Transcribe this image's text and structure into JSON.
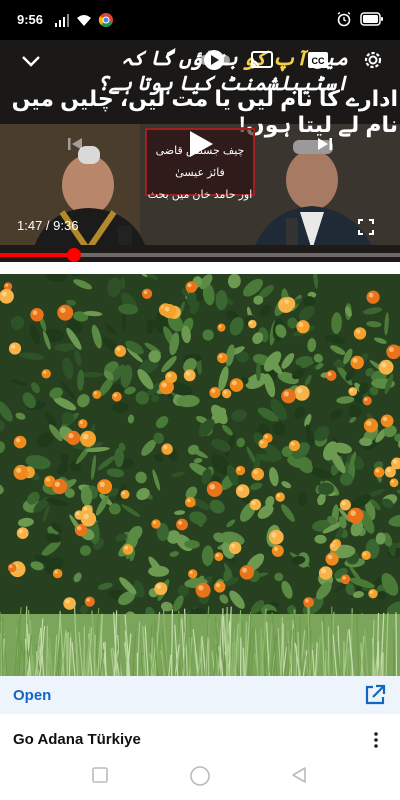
{
  "status_bar": {
    "time": "9:56",
    "icons_left": [
      "signal-icon",
      "wifi-icon",
      "chrome-icon"
    ],
    "icons_right": [
      "alarm-icon",
      "battery-icon"
    ]
  },
  "video": {
    "title_overlay_line1_prefix": "میں",
    "title_overlay_line1_highlight": "آپ کو",
    "title_overlay_line1_rest": "بتاؤں گا کہ اسٹیبلشمنٹ کیا ہوتا ہے؟",
    "title_overlay_line2": "ادارے کا نام لیں یا مت لیں، چلیں میں نام لے لیتا ہوں!",
    "label_box_line1": "چیف جسٹس قاضی فائز عیسیٰ",
    "label_box_line2": "اور حامد خان میں بحث",
    "current_time": "1:47",
    "duration": "9:36",
    "time_display": "1:47 / 9:36",
    "progress_fraction": 0.186,
    "controls": [
      "collapse-icon",
      "autoplay-toggle",
      "cast-icon",
      "captions-icon",
      "settings-icon",
      "previous-icon",
      "play-icon",
      "next-icon",
      "fullscreen-icon"
    ]
  },
  "ad": {
    "open_label": "Open",
    "advertiser": "Go Adana Türkiye"
  },
  "nav": {
    "buttons": [
      "recent-apps-button",
      "home-button",
      "back-button"
    ]
  },
  "colors": {
    "accent_red": "#ff0000",
    "open_blue": "#1565c0",
    "highlight_yellow": "#f2d048"
  }
}
